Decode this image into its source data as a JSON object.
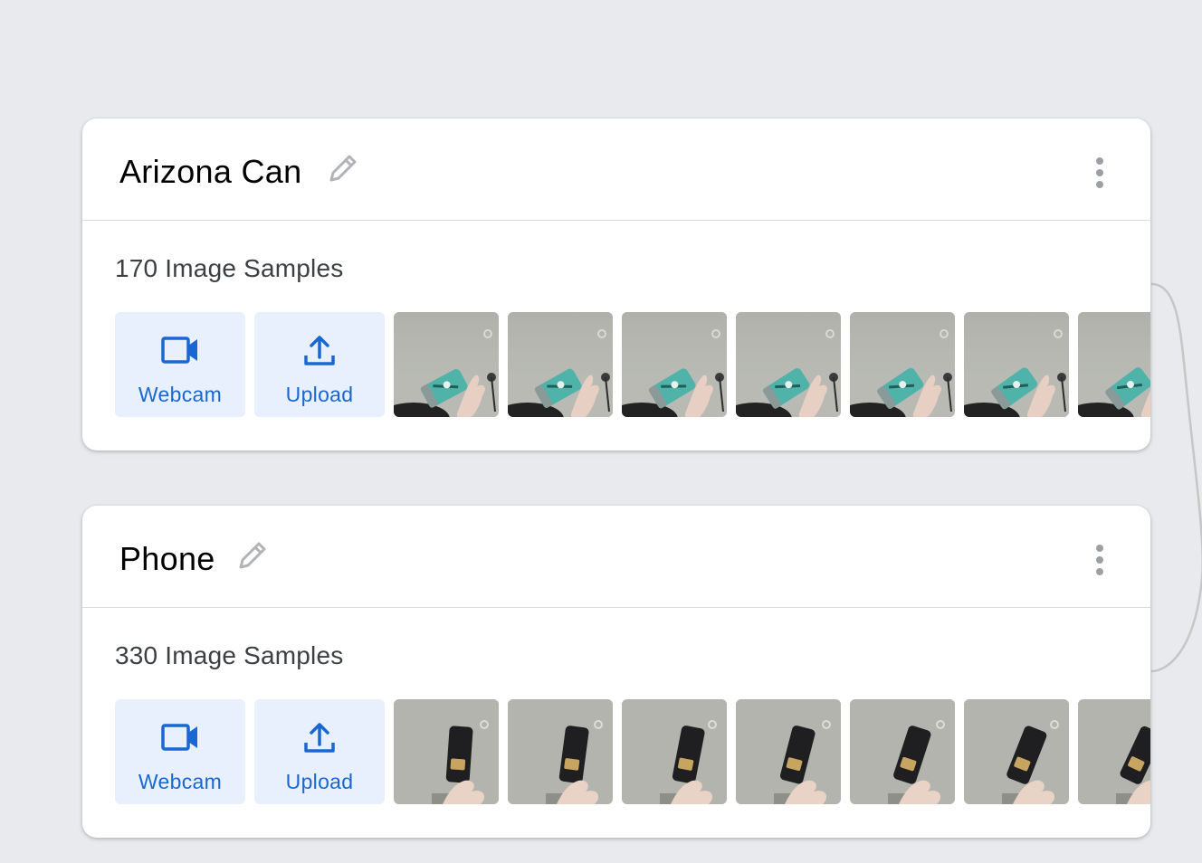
{
  "classes": [
    {
      "title": "Arizona Can",
      "sample_count": "170 Image Samples",
      "webcam_label": "Webcam",
      "upload_label": "Upload",
      "thumbnail_subject": "teal can held in hand",
      "thumbnail_count": 7
    },
    {
      "title": "Phone",
      "sample_count": "330 Image Samples",
      "webcam_label": "Webcam",
      "upload_label": "Upload",
      "thumbnail_subject": "black phone held in hand",
      "thumbnail_count": 7
    }
  ],
  "icons": {
    "edit": "pencil-icon",
    "more": "more-vert-icon",
    "webcam": "videocam-icon",
    "upload": "upload-icon"
  },
  "colors": {
    "background": "#e8eaed",
    "card": "#ffffff",
    "accent": "#1967d2",
    "button_bg": "#e8f0fe",
    "icon_gray": "#9aa0a6",
    "can": "#4fb3aa"
  }
}
